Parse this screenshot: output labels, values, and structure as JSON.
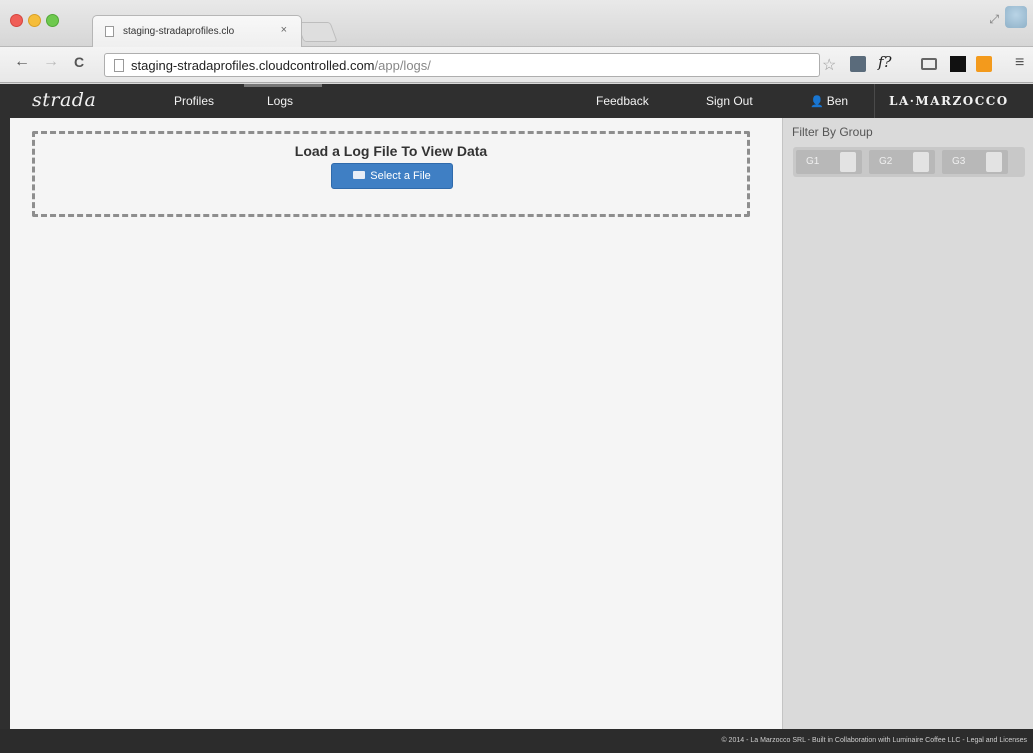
{
  "browser": {
    "tab_title": "staging-stradaprofiles.clo",
    "tab_close": "×",
    "url_host": "staging-stradaprofiles.cloudcontrolled.com",
    "url_path": "/app/logs/",
    "ext_formula": "f?"
  },
  "nav": {
    "brand": "strada",
    "profiles": "Profiles",
    "logs": "Logs",
    "feedback": "Feedback",
    "sign_out": "Sign Out",
    "user": "Ben",
    "brand_right": "LA·MARZOCCO"
  },
  "main": {
    "drop_title": "Load a Log File To View Data",
    "select_button": "Select a File"
  },
  "sidebar": {
    "title": "Filter By Group",
    "groups": [
      "G1",
      "G2",
      "G3"
    ]
  },
  "footer": {
    "text": "© 2014 - La Marzocco SRL - Built in Collaboration with Luminaire Coffee LLC - Legal and Licenses"
  }
}
